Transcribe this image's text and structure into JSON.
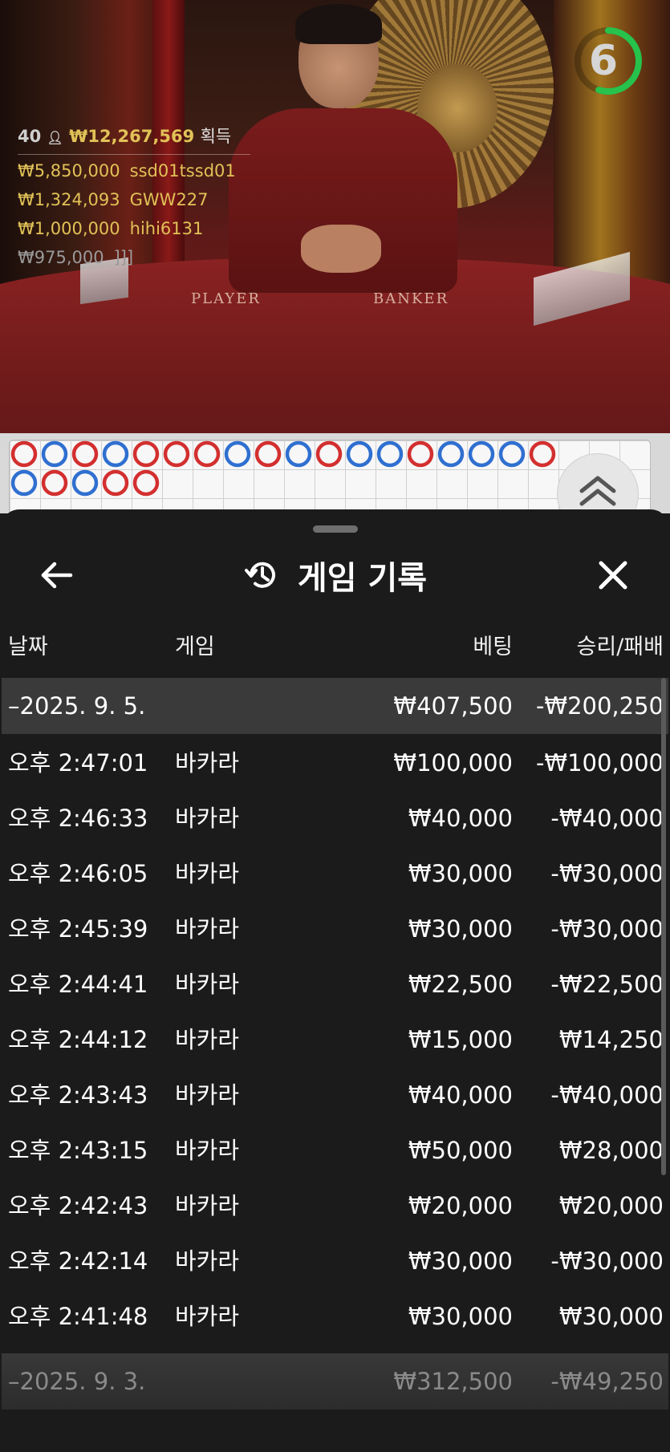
{
  "stream": {
    "table_labels": {
      "player": "PLAYER",
      "banker": "BANKER"
    },
    "winners": {
      "header": {
        "count": "40",
        "total": "₩12,267,569",
        "label": "획득"
      },
      "list": [
        {
          "amount": "₩5,850,000",
          "name": "ssd01tssd01"
        },
        {
          "amount": "₩1,324,093",
          "name": "GWW227"
        },
        {
          "amount": "₩1,000,000",
          "name": "hihi6131"
        },
        {
          "amount": "₩975,000",
          "name": "]]]"
        }
      ]
    },
    "countdown": {
      "value": "6",
      "remaining_fraction": 0.55
    },
    "colors": {
      "player": "#2f6fd0",
      "banker": "#d32f2f",
      "tie": "#2e9e3e",
      "timer": "#27c24c",
      "winner_text": "#e1c257"
    }
  },
  "road_map": {
    "bead_row1": [
      "B",
      "P",
      "B",
      "P",
      "B",
      "B",
      "B",
      "P",
      "B",
      "P",
      "B",
      "P",
      "P",
      "B",
      "P",
      "P",
      "P",
      "B"
    ],
    "bead_row2": [
      "P",
      "B",
      "P",
      "B",
      "B"
    ]
  },
  "panel": {
    "title": "게임 기록",
    "icons": {
      "back": "back-arrow-icon",
      "history": "history-icon",
      "close": "close-icon",
      "expand": "chevron-up-double-icon"
    },
    "columns": {
      "date": "날짜",
      "game": "게임",
      "bet": "베팅",
      "result": "승리/패배"
    },
    "day1": {
      "date": "–2025. 9. 5.",
      "bet": "₩407,500",
      "result": "-₩200,250"
    },
    "rows": [
      {
        "time": "오후 2:47:01",
        "game": "바카라",
        "bet": "₩100,000",
        "result": "-₩100,000"
      },
      {
        "time": "오후 2:46:33",
        "game": "바카라",
        "bet": "₩40,000",
        "result": "-₩40,000"
      },
      {
        "time": "오후 2:46:05",
        "game": "바카라",
        "bet": "₩30,000",
        "result": "-₩30,000"
      },
      {
        "time": "오후 2:45:39",
        "game": "바카라",
        "bet": "₩30,000",
        "result": "-₩30,000"
      },
      {
        "time": "오후 2:44:41",
        "game": "바카라",
        "bet": "₩22,500",
        "result": "-₩22,500"
      },
      {
        "time": "오후 2:44:12",
        "game": "바카라",
        "bet": "₩15,000",
        "result": "₩14,250"
      },
      {
        "time": "오후 2:43:43",
        "game": "바카라",
        "bet": "₩40,000",
        "result": "-₩40,000"
      },
      {
        "time": "오후 2:43:15",
        "game": "바카라",
        "bet": "₩50,000",
        "result": "₩28,000"
      },
      {
        "time": "오후 2:42:43",
        "game": "바카라",
        "bet": "₩20,000",
        "result": "₩20,000"
      },
      {
        "time": "오후 2:42:14",
        "game": "바카라",
        "bet": "₩30,000",
        "result": "-₩30,000"
      },
      {
        "time": "오후 2:41:48",
        "game": "바카라",
        "bet": "₩30,000",
        "result": "₩30,000"
      }
    ],
    "day2": {
      "date": "–2025. 9. 3.",
      "bet": "₩312,500",
      "result": "-₩49,250"
    }
  }
}
